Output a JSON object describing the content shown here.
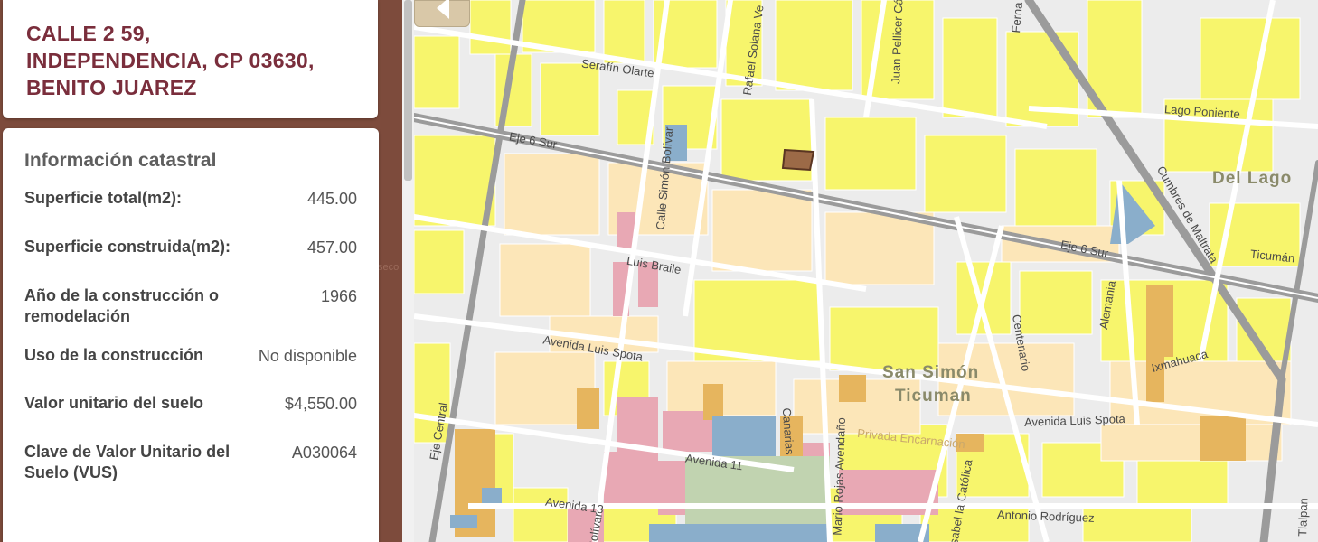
{
  "address": {
    "line1": "CALLE 2 59,",
    "line2": "INDEPENDENCIA, CP 03630,",
    "line3": "BENITO JUAREZ"
  },
  "info": {
    "title": "Información catastral",
    "rows": [
      {
        "label": "Superficie total(m2):",
        "value": "445.00"
      },
      {
        "label": "Superficie construida(m2):",
        "value": "457.00"
      },
      {
        "label": "Año de la construcción o remodelación",
        "value": "1966"
      },
      {
        "label": "Uso de la construcción",
        "value": "No disponible"
      },
      {
        "label": "Valor unitario del suelo",
        "value": "$4,550.00"
      },
      {
        "label": "Clave de Valor Unitario del Suelo (VUS)",
        "value": "A030064"
      }
    ]
  },
  "map": {
    "streets": {
      "serafin": "Serafín Olarte",
      "rafael": "Rafael Solana Ve",
      "juan": "Juan Pellicer Cá",
      "ferna": "Ferna",
      "lago_poniente": "Lago Poniente",
      "eje6_left": "Eje 6 Sur",
      "eje6_right": "Eje 6 Sur",
      "simon_bolivar": "Calle Simón Bolívar",
      "cumbres": "Cumbres de Maltrata",
      "ticuman": "Ticumán",
      "luis_braile": "Luis Braile",
      "centenario": "Centenario",
      "alemania": "Alemania",
      "luis_spota_left": "Avenida Luis Spota",
      "luis_spota_right": "Avenida Luis Spota",
      "ixmahuaca": "Ixmahuaca",
      "eje_central": "Eje Central",
      "canarias": "Canarias",
      "privada": "Privada Encarnación",
      "avenida11": "Avenida 11",
      "avenida13": "Avenida 13",
      "mario": "Mario Rojas Avendaño",
      "isabel": "Isabel la Católica",
      "antonio": "Antonio Rodríguez",
      "bolivar2": "Bolívar",
      "tlalpan": "Tlalpan"
    },
    "neighborhoods": {
      "del_lago": "Del Lago",
      "san_simon": "San Simón",
      "ticuman": "Ticuman"
    }
  },
  "colors": {
    "brand": "#7a2e3c",
    "parcel_yellow": "#f7f56c",
    "parcel_cream": "#fce6b8",
    "parcel_orange": "#e6b55e",
    "parcel_pink": "#e8a8b4",
    "parcel_blue": "#8aaecb",
    "parcel_green": "#c1d3b0",
    "highlight": "#9c6a47"
  }
}
